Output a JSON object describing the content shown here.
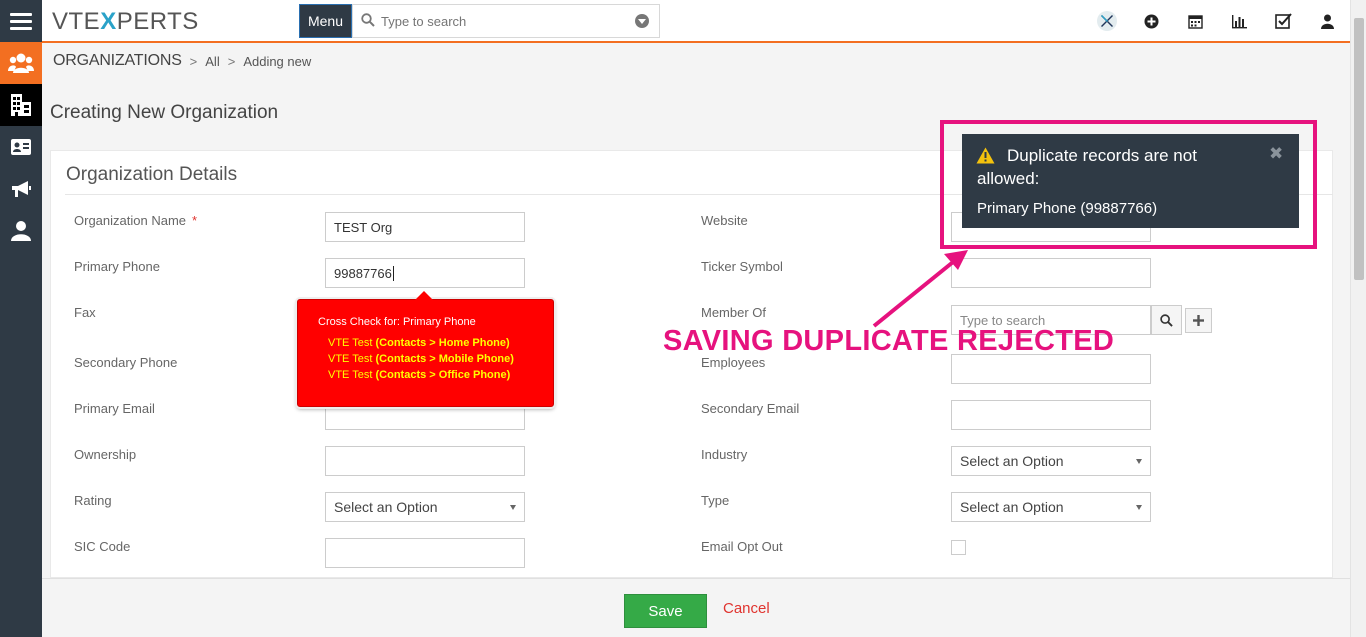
{
  "app": {
    "logo_left": "VTE",
    "logo_mid": "X",
    "logo_right": "PERTS",
    "menu_label": "Menu",
    "search_placeholder": "Type to search"
  },
  "breadcrumb": {
    "module": "ORGANIZATIONS",
    "filter": "All",
    "current": "Adding new"
  },
  "page_title": "Creating New Organization",
  "section_title": "Organization Details",
  "form": {
    "org_name_label": "Organization Name",
    "required_mark": "*",
    "org_name_value": "TEST Org",
    "primary_phone_label": "Primary Phone",
    "primary_phone_value": "99887766",
    "fax_label": "Fax",
    "secondary_phone_label": "Secondary Phone",
    "primary_email_label": "Primary Email",
    "ownership_label": "Ownership",
    "rating_label": "Rating",
    "rating_value": "Select an Option",
    "sic_code_label": "SIC Code",
    "website_label": "Website",
    "ticker_label": "Ticker Symbol",
    "member_of_label": "Member Of",
    "member_of_placeholder": "Type to search",
    "employees_label": "Employees",
    "secondary_email_label": "Secondary Email",
    "industry_label": "Industry",
    "industry_value": "Select an Option",
    "type_label": "Type",
    "type_value": "Select an Option",
    "email_opt_out_label": "Email Opt Out"
  },
  "cross_check": {
    "title": "Cross Check for: Primary Phone",
    "lines": [
      {
        "name": "VTE Test",
        "open": " (",
        "path": "Contacts > Home Phone",
        "close": ")"
      },
      {
        "name": "VTE Test",
        "open": " (",
        "path": "Contacts > Mobile Phone",
        "close": ")"
      },
      {
        "name": "VTE Test",
        "open": " (",
        "path": "Contacts > Office Phone",
        "close": ")"
      }
    ]
  },
  "notification": {
    "line1": "Duplicate records are not",
    "line2": "allowed:",
    "detail": "Primary Phone (99887766)",
    "close_glyph": "✖"
  },
  "annotation": "SAVING DUPLICATE REJECTED",
  "footer": {
    "save_label": "Save",
    "cancel_label": "Cancel"
  },
  "colors": {
    "accent": "#f36f21",
    "rail": "#2f3a45",
    "save_green": "#35aa47",
    "highlight_pink": "#e6127e",
    "error_red": "#ff0000"
  }
}
